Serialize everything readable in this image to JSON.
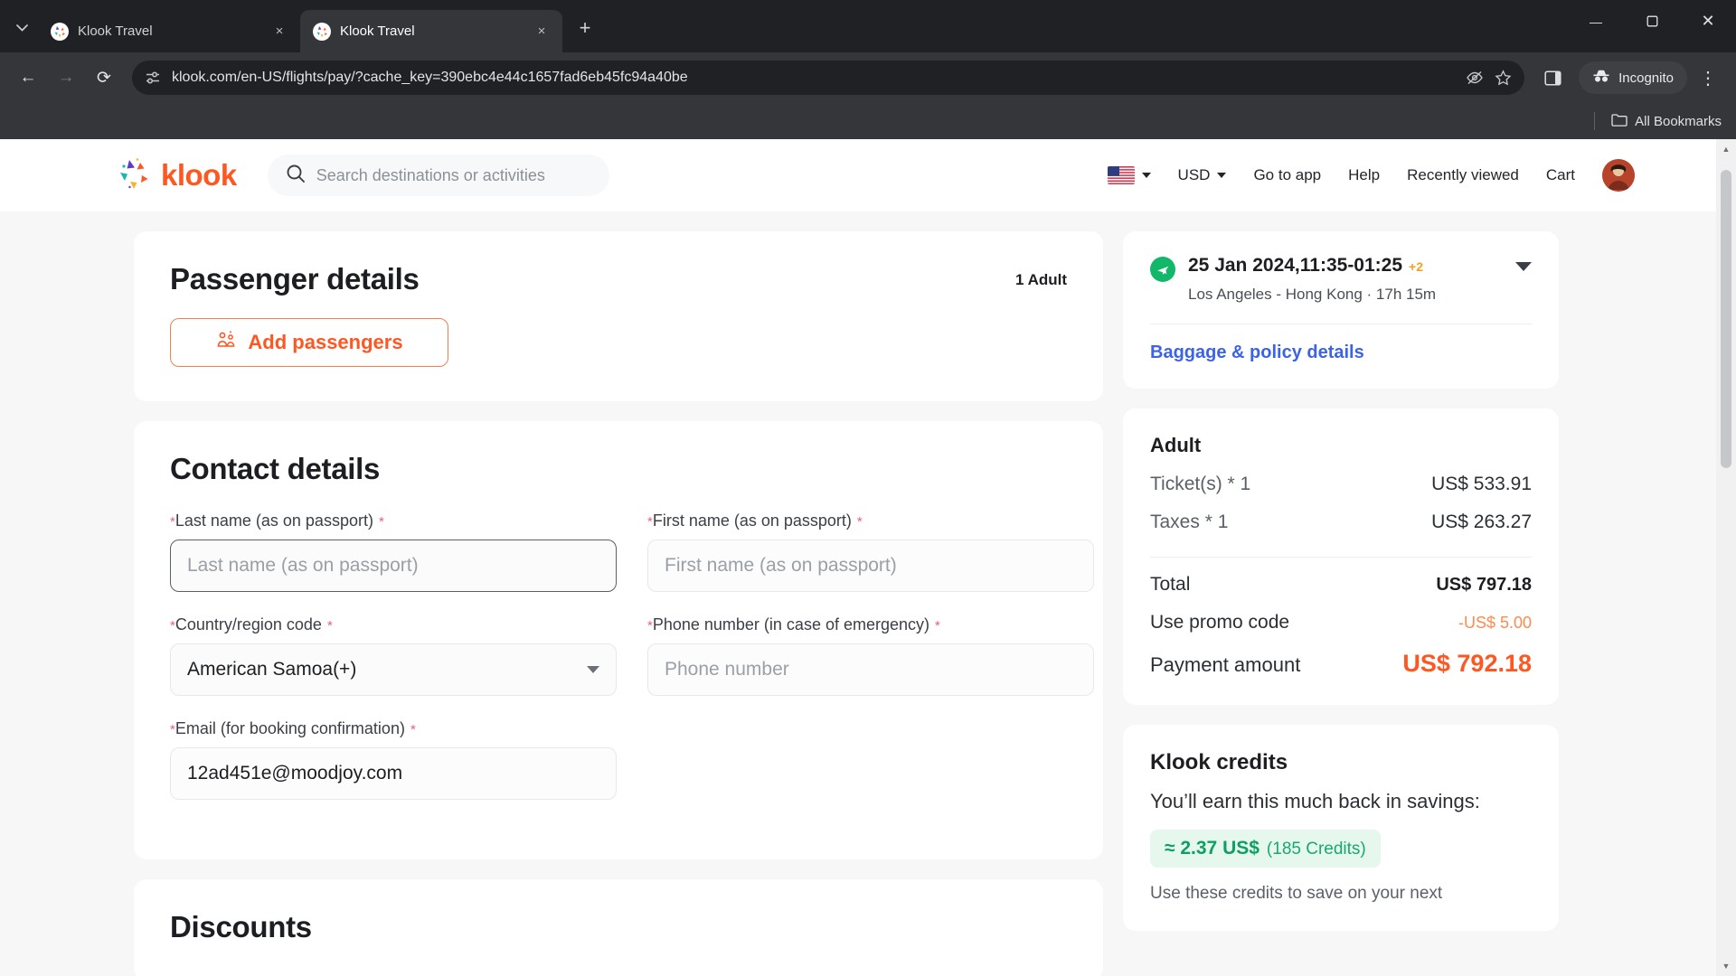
{
  "browser": {
    "tabs": [
      {
        "title": "Klook Travel",
        "active": false
      },
      {
        "title": "Klook Travel",
        "active": true
      }
    ],
    "new_tab_label": "+",
    "close_label": "×",
    "window": {
      "minimize": "—",
      "maximize": "❐",
      "close": "✕"
    },
    "nav": {
      "back": "←",
      "forward": "→",
      "reload": "⟳"
    },
    "url": "klook.com/en-US/flights/pay/?cache_key=390ebc4e44c1657fad6eb45fc94a40be",
    "incognito_label": "Incognito",
    "menu_label": "⋮",
    "bookmarks_label": "All Bookmarks"
  },
  "site_header": {
    "logo_text": "klook",
    "search_placeholder": "Search destinations or activities",
    "currency": "USD",
    "links": [
      "Go to app",
      "Help",
      "Recently viewed",
      "Cart"
    ]
  },
  "passenger_details": {
    "title": "Passenger details",
    "count": "1 Adult",
    "add_button": "Add passengers"
  },
  "contact_details": {
    "title": "Contact details",
    "fields": [
      {
        "label": "Last name (as on passport)",
        "placeholder": "Last name (as on passport)",
        "value": ""
      },
      {
        "label": "First name (as on passport)",
        "placeholder": "First name (as on passport)",
        "value": ""
      },
      {
        "label": "Country/region code",
        "value": "American Samoa(+)"
      },
      {
        "label": "Phone number (in case of emergency)",
        "placeholder": "Phone number",
        "value": ""
      },
      {
        "label": "Email (for booking confirmation)",
        "value": "12ad451e@moodjoy.com"
      }
    ],
    "required_mark": "*"
  },
  "discounts": {
    "title": "Discounts"
  },
  "flight_summary": {
    "datetime": "25 Jan 2024,11:35-01:25",
    "day_offset": "+2",
    "route": "Los Angeles - Hong Kong · 17h 15m",
    "baggage_link": "Baggage & policy details"
  },
  "price_summary": {
    "heading": "Adult",
    "lines": [
      {
        "label": "Ticket(s) * 1",
        "value": "US$ 533.91"
      },
      {
        "label": "Taxes * 1",
        "value": "US$ 263.27"
      }
    ],
    "total_label": "Total",
    "total_value": "US$ 797.18",
    "promo_label": "Use promo code",
    "promo_value": "-US$ 5.00",
    "payment_label": "Payment amount",
    "payment_value": "US$ 792.18"
  },
  "klook_credits": {
    "title": "Klook credits",
    "subtitle": "You’ll earn this much back in savings:",
    "amount": "≈ 2.37 US$",
    "credits": "(185 Credits)",
    "note": "Use these credits to save on your next"
  },
  "colors": {
    "brand_orange": "#ff5722",
    "link_blue": "#3b63e8",
    "green": "#12b76a",
    "required_pink": "#e8607a"
  }
}
